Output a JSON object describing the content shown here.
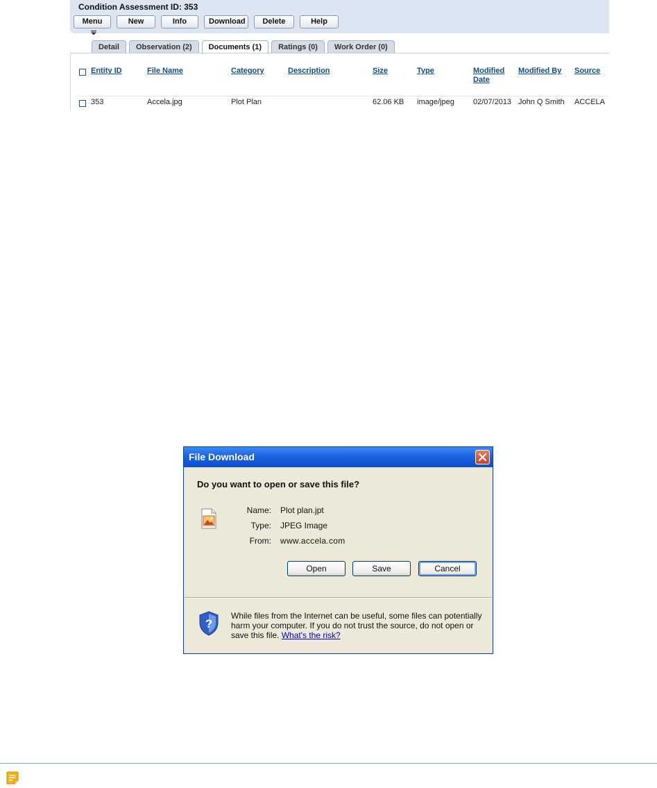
{
  "header": {
    "title": "Condition Assessment ID: 353"
  },
  "toolbar": {
    "menu_label": "Menu",
    "menu_icon": "dropdown-arrow-icon",
    "new_label": "New",
    "info_label": "Info",
    "download_label": "Download",
    "delete_label": "Delete",
    "help_label": "Help"
  },
  "tabs": [
    {
      "label": "Detail"
    },
    {
      "label": "Observation (2)"
    },
    {
      "label": "Documents (1)",
      "active": true
    },
    {
      "label": "Ratings (0)"
    },
    {
      "label": "Work Order (0)"
    }
  ],
  "table": {
    "columns": {
      "entity_id": "Entity ID",
      "file_name": "File Name",
      "category": "Category",
      "description": "Description",
      "size": "Size",
      "type": "Type",
      "modified_date_1": "Modified",
      "modified_date_2": "Date",
      "modified_by": "Modified By",
      "source": "Source"
    },
    "rows": [
      {
        "entity_id": "353",
        "file_name": "Accela.jpg",
        "category": "Plot Plan",
        "description": "",
        "size": "62.06 KB",
        "type": "image/jpeg",
        "modified_date": "02/07/2013",
        "modified_by": "John Q Smith",
        "source": "ACCELA"
      }
    ]
  },
  "dialog": {
    "title": "File Download",
    "question": "Do you want to open or save this file?",
    "name_label": "Name:",
    "name_value": "Plot plan.jpt",
    "type_label": "Type:",
    "type_value": "JPEG Image",
    "from_label": "From:",
    "from_value": "www.accela.com",
    "open_label": "Open",
    "save_label": "Save",
    "cancel_label": "Cancel",
    "warning_text": "While files from the Internet can be useful, some files can potentially harm your computer. If you do not trust the source, do not open or save this file.",
    "risk_link": "What's the risk?"
  },
  "colors": {
    "header_bg": "#dbe6f2",
    "link_blue": "#0f4e8a",
    "xp_title_blue": "#1d62e2",
    "dialog_bg": "#ece9d8",
    "note_line": "#76b6c8",
    "note_icon": "#f2b21b"
  },
  "icons": {
    "file_icon": "jpeg-file-icon",
    "shield_icon": "security-shield-icon",
    "close_icon": "close-x-icon",
    "note_icon": "note-icon"
  }
}
